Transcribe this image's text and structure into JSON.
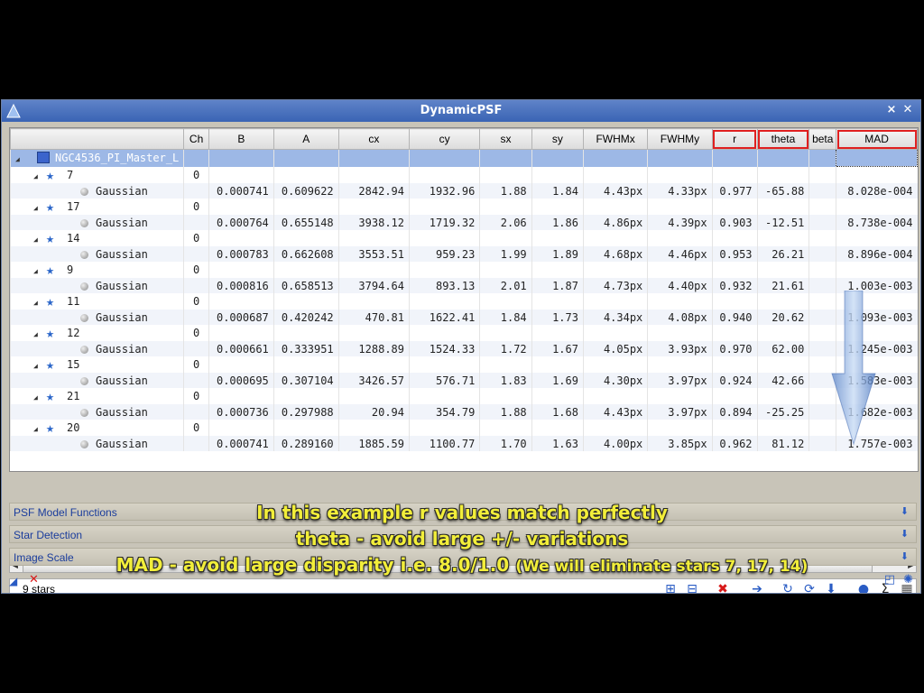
{
  "window": {
    "title": "DynamicPSF"
  },
  "table": {
    "columns": [
      "",
      "Ch",
      "B",
      "A",
      "cx",
      "cy",
      "sx",
      "sy",
      "FWHMx",
      "FWHMy",
      "r",
      "theta",
      "beta",
      "MAD"
    ],
    "highlighted_columns": [
      "r",
      "theta",
      "MAD"
    ],
    "root": {
      "label": "NGC4536_PI_Master_L"
    },
    "stars": [
      {
        "id": "7",
        "ch": "0",
        "model": "Gaussian",
        "B": "0.000741",
        "A": "0.609622",
        "cx": "2842.94",
        "cy": "1932.96",
        "sx": "1.88",
        "sy": "1.84",
        "FWHMx": "4.43px",
        "FWHMy": "4.33px",
        "r": "0.977",
        "theta": "-65.88",
        "beta": "",
        "MAD": "8.028e-004"
      },
      {
        "id": "17",
        "ch": "0",
        "model": "Gaussian",
        "B": "0.000764",
        "A": "0.655148",
        "cx": "3938.12",
        "cy": "1719.32",
        "sx": "2.06",
        "sy": "1.86",
        "FWHMx": "4.86px",
        "FWHMy": "4.39px",
        "r": "0.903",
        "theta": "-12.51",
        "beta": "",
        "MAD": "8.738e-004"
      },
      {
        "id": "14",
        "ch": "0",
        "model": "Gaussian",
        "B": "0.000783",
        "A": "0.662608",
        "cx": "3553.51",
        "cy": "959.23",
        "sx": "1.99",
        "sy": "1.89",
        "FWHMx": "4.68px",
        "FWHMy": "4.46px",
        "r": "0.953",
        "theta": "26.21",
        "beta": "",
        "MAD": "8.896e-004"
      },
      {
        "id": "9",
        "ch": "0",
        "model": "Gaussian",
        "B": "0.000816",
        "A": "0.658513",
        "cx": "3794.64",
        "cy": "893.13",
        "sx": "2.01",
        "sy": "1.87",
        "FWHMx": "4.73px",
        "FWHMy": "4.40px",
        "r": "0.932",
        "theta": "21.61",
        "beta": "",
        "MAD": "1.003e-003"
      },
      {
        "id": "11",
        "ch": "0",
        "model": "Gaussian",
        "B": "0.000687",
        "A": "0.420242",
        "cx": "470.81",
        "cy": "1622.41",
        "sx": "1.84",
        "sy": "1.73",
        "FWHMx": "4.34px",
        "FWHMy": "4.08px",
        "r": "0.940",
        "theta": "20.62",
        "beta": "",
        "MAD": "1.093e-003"
      },
      {
        "id": "12",
        "ch": "0",
        "model": "Gaussian",
        "B": "0.000661",
        "A": "0.333951",
        "cx": "1288.89",
        "cy": "1524.33",
        "sx": "1.72",
        "sy": "1.67",
        "FWHMx": "4.05px",
        "FWHMy": "3.93px",
        "r": "0.970",
        "theta": "62.00",
        "beta": "",
        "MAD": "1.245e-003"
      },
      {
        "id": "15",
        "ch": "0",
        "model": "Gaussian",
        "B": "0.000695",
        "A": "0.307104",
        "cx": "3426.57",
        "cy": "576.71",
        "sx": "1.83",
        "sy": "1.69",
        "FWHMx": "4.30px",
        "FWHMy": "3.97px",
        "r": "0.924",
        "theta": "42.66",
        "beta": "",
        "MAD": "1.583e-003"
      },
      {
        "id": "21",
        "ch": "0",
        "model": "Gaussian",
        "B": "0.000736",
        "A": "0.297988",
        "cx": "20.94",
        "cy": "354.79",
        "sx": "1.88",
        "sy": "1.68",
        "FWHMx": "4.43px",
        "FWHMy": "3.97px",
        "r": "0.894",
        "theta": "-25.25",
        "beta": "",
        "MAD": "1.682e-003"
      },
      {
        "id": "20",
        "ch": "0",
        "model": "Gaussian",
        "B": "0.000741",
        "A": "0.289160",
        "cx": "1885.59",
        "cy": "1100.77",
        "sx": "1.70",
        "sy": "1.63",
        "FWHMx": "4.00px",
        "FWHMy": "3.85px",
        "r": "0.962",
        "theta": "81.12",
        "beta": "",
        "MAD": "1.757e-003"
      }
    ]
  },
  "status": {
    "count": "9 stars"
  },
  "sections": [
    {
      "label": "PSF Model Functions"
    },
    {
      "label": "Star Detection"
    },
    {
      "label": "Image Scale"
    }
  ],
  "overlay": {
    "line1": "In this example r values match perfectly",
    "line2": "theta - avoid large +/- variations",
    "line3_main": "MAD - avoid large disparity i.e. 8.0/1.0",
    "line3_note": "(We will eliminate stars 7, 17, 14)"
  },
  "colors": {
    "title_bar": "#3a64b4",
    "highlight": "#e02020",
    "caption": "#f2ee3a",
    "row_selected": "#9db8e6"
  },
  "icons": [
    "expand-all-icon",
    "collapse-all-icon",
    "delete-icon",
    "move-right-icon",
    "recompute-icon",
    "refresh-icon",
    "move-down-icon",
    "star-ball-icon",
    "sigma-icon",
    "table-icon"
  ]
}
